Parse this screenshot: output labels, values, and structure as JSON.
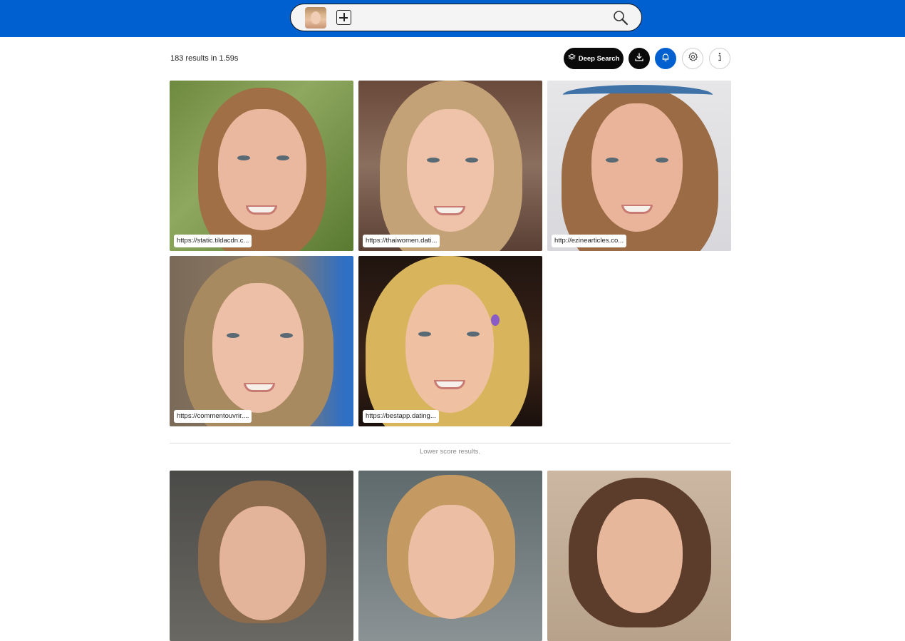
{
  "search": {
    "query_image_alt": "query face thumbnail"
  },
  "toolbar": {
    "results_count": "183 results in 1.59s",
    "deep_search_label": "Deep Search"
  },
  "results": [
    {
      "url": "https://static.tildacdn.c..."
    },
    {
      "url": "https://thaiwomen.dati..."
    },
    {
      "url": "http://ezinearticles.co..."
    },
    {
      "url": "https://commentouvrir...."
    },
    {
      "url": "https://bestapp.dating..."
    }
  ],
  "lower_section": {
    "label": "Lower score results."
  },
  "colors": {
    "brand_blue": "#0060cf",
    "black_button": "#0a0a0a"
  }
}
